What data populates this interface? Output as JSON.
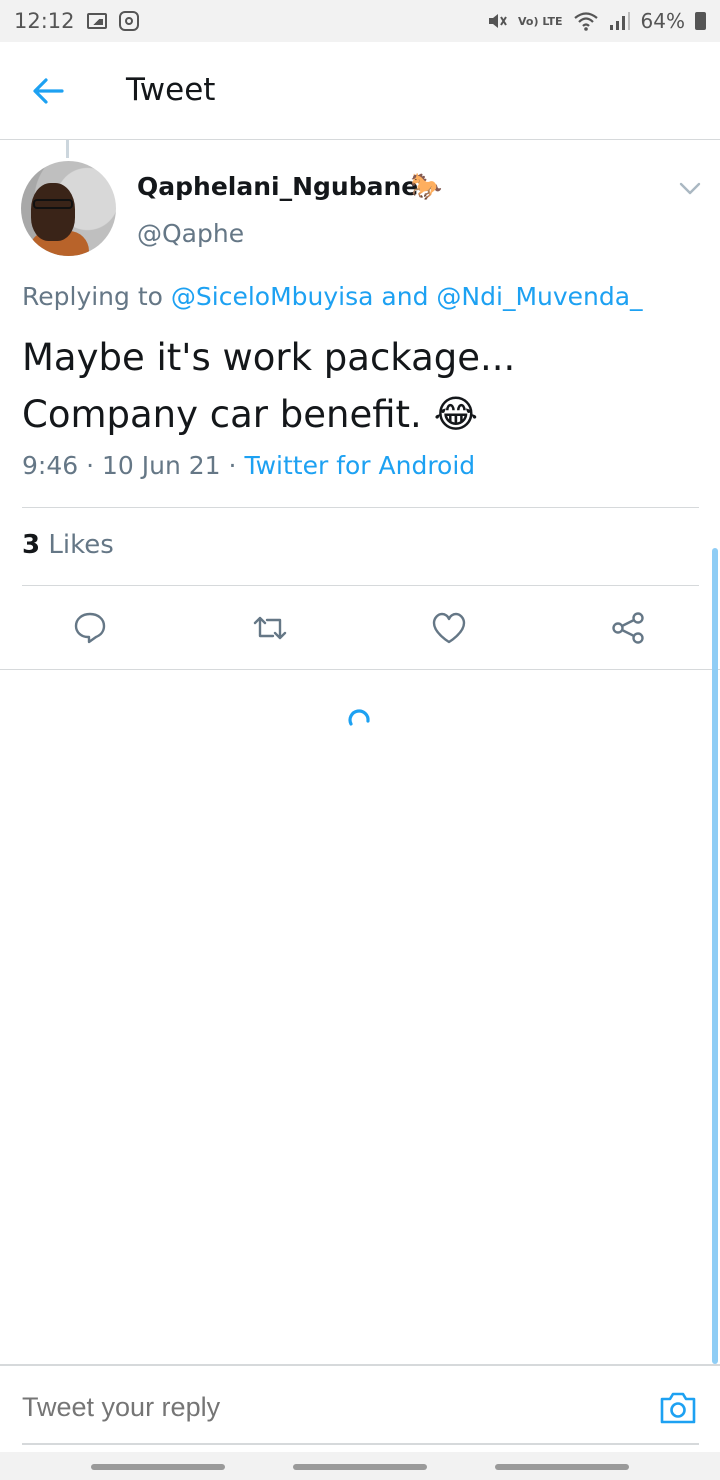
{
  "status_bar": {
    "time": "12:12",
    "lte_label": "Vo) LTE",
    "battery": "64%"
  },
  "header": {
    "title": "Tweet",
    "back_icon": "arrow-left-icon"
  },
  "tweet": {
    "author_name": "Qaphelani_Ngubane",
    "author_emoji": "🐎",
    "handle": "@Qaphe",
    "replying_prefix": "Replying to",
    "mention_1": "@SiceloMbuyisa",
    "replying_and": "and",
    "mention_2": "@Ndi_Muvenda_",
    "text_line1": "Maybe it's work package...",
    "text_line2": "Company car benefit.",
    "text_emoji": "😂",
    "time": "9:46",
    "date": "10 Jun 21",
    "separator": "·",
    "source": "Twitter for Android",
    "likes_count": "3",
    "likes_label": "Likes"
  },
  "actions": {
    "reply_icon": "comment-icon",
    "retweet_icon": "retweet-icon",
    "like_icon": "heart-icon",
    "share_icon": "share-icon"
  },
  "reply_bar": {
    "placeholder": "Tweet your reply",
    "camera_icon": "camera-icon"
  },
  "colors": {
    "accent": "#1da1f2",
    "secondary_text": "#657786",
    "divider": "#d6d9db"
  }
}
